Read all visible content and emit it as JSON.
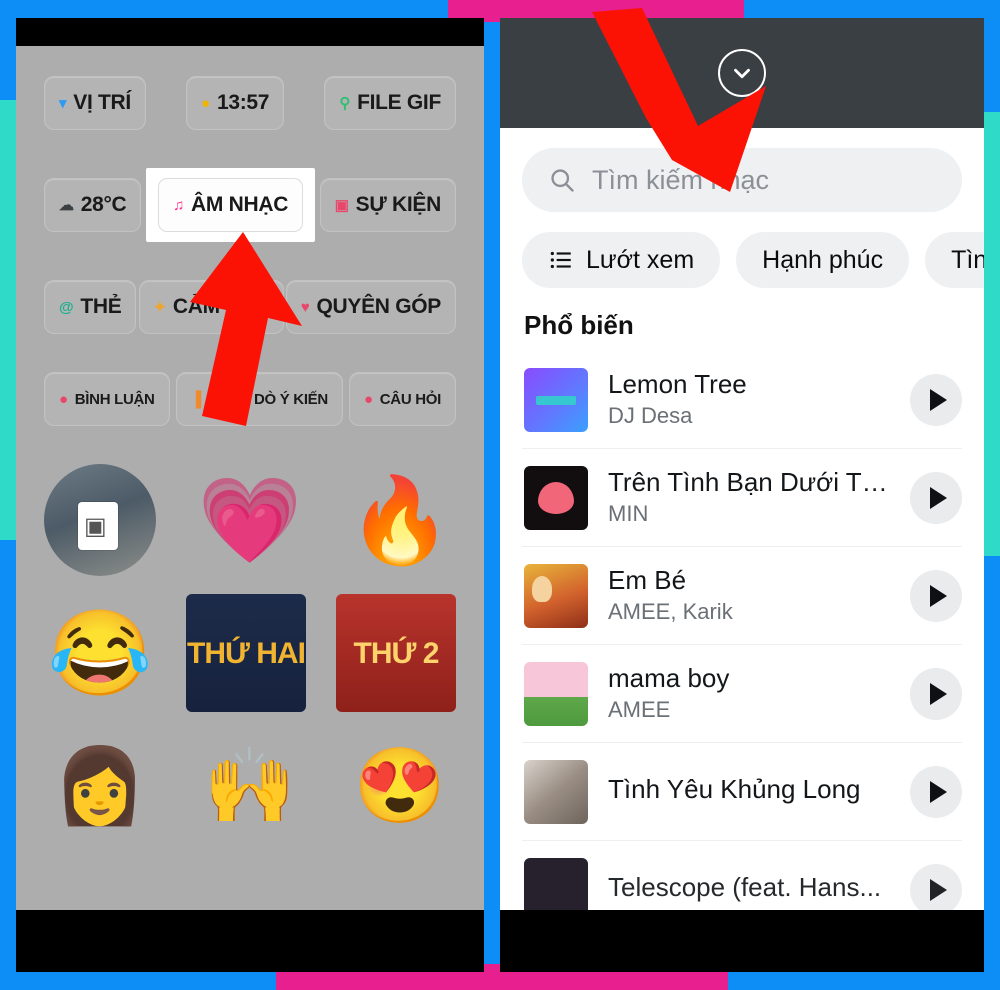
{
  "frame": {
    "accent_blue": "#0d8ef7",
    "accent_teal": "#2fdac8",
    "accent_pink": "#e81f8e",
    "arrow_color": "#fb1205"
  },
  "left_panel": {
    "name": "facebook-story-sticker-tray",
    "background": "#adadad",
    "chip_rows": [
      [
        {
          "label": "VỊ TRÍ",
          "icon": "location-pin-icon",
          "icon_glyph": "▾",
          "icon_color": "#2e9bf0"
        },
        {
          "label": "13:57",
          "icon": "clock-icon",
          "icon_glyph": "●",
          "icon_color": "#f0b400"
        },
        {
          "label": "FILE GIF",
          "icon": "gif-search-icon",
          "icon_glyph": "⚲",
          "icon_color": "#2fbf71"
        }
      ],
      [
        {
          "label": "28°C",
          "icon": "weather-cloud-icon",
          "icon_glyph": "☁",
          "icon_color": "#3c4043"
        },
        {
          "label": "ÂM NHẠC",
          "icon": "music-note-icon",
          "icon_glyph": "♫",
          "icon_color": "#ff2d8d",
          "highlighted": true
        },
        {
          "label": "SỰ KIỆN",
          "icon": "calendar-icon",
          "icon_glyph": "▣",
          "icon_color": "#e8466a"
        }
      ],
      [
        {
          "label": "THẺ",
          "icon": "mention-at-icon",
          "icon_glyph": "@",
          "icon_color": "#1fae8f"
        },
        {
          "label": "CẢM XÚC",
          "icon": "feeling-star-icon",
          "icon_glyph": "✦",
          "icon_color": "#f0a52a"
        },
        {
          "label": "QUYÊN GÓP",
          "icon": "donate-heart-icon",
          "icon_glyph": "♥",
          "icon_color": "#e8466a"
        }
      ],
      [
        {
          "label": "BÌNH LUẬN",
          "icon": "comment-bubble-icon",
          "icon_glyph": "●",
          "icon_color": "#e8466a",
          "small": true
        },
        {
          "label": "THĂM DÒ Ý KIẾN",
          "icon": "poll-bars-icon",
          "icon_glyph": "▐",
          "icon_color": "#f08a2a",
          "small": true
        },
        {
          "label": "CÂU HỎI",
          "icon": "question-bubble-icon",
          "icon_glyph": "●",
          "icon_color": "#e8466a",
          "small": true
        }
      ]
    ],
    "sticker_rows": [
      [
        {
          "name": "avatar-photo-sticker",
          "kind": "avatar"
        },
        {
          "name": "heart-face-sticker",
          "kind": "emoji",
          "glyph": "💗"
        },
        {
          "name": "fire-sticker",
          "kind": "emoji",
          "glyph": "🔥"
        }
      ],
      [
        {
          "name": "joy-emoji-sticker",
          "kind": "emoji",
          "glyph": "😂"
        },
        {
          "name": "thu-hai-text-sticker",
          "kind": "text",
          "text": "THỨ HAI"
        },
        {
          "name": "thu-2-text-sticker",
          "kind": "text",
          "text": "THỨ 2"
        }
      ],
      [
        {
          "name": "memoji-glasses-sticker",
          "kind": "emoji",
          "glyph": "👩"
        },
        {
          "name": "memoji-yes-sticker",
          "kind": "emoji",
          "glyph": "🙌"
        },
        {
          "name": "memoji-hearteyes-sticker",
          "kind": "emoji",
          "glyph": "😍"
        }
      ]
    ]
  },
  "right_panel": {
    "name": "music-picker-sheet",
    "collapse_icon": "chevron-down-circle-icon",
    "search": {
      "icon": "search-icon",
      "placeholder": "Tìm kiếm nhạc",
      "value": ""
    },
    "category_pills": [
      {
        "label": "Lướt xem",
        "icon": "list-icon"
      },
      {
        "label": "Hạnh phúc",
        "icon": ""
      },
      {
        "label": "Tình y",
        "icon": ""
      }
    ],
    "section_title": "Phổ biến",
    "songs": [
      {
        "title": "Lemon Tree",
        "artist": "DJ Desa",
        "art": "art-lemon",
        "play_icon": "play-icon"
      },
      {
        "title": "Trên Tình Bạn Dưới Tìn...",
        "artist": "MIN",
        "art": "art-tren",
        "play_icon": "play-icon"
      },
      {
        "title": "Em Bé",
        "artist": "AMEE, Karik",
        "art": "art-embe",
        "play_icon": "play-icon"
      },
      {
        "title": "mama boy",
        "artist": "AMEE",
        "art": "art-mama",
        "play_icon": "play-icon"
      },
      {
        "title": "Tình Yêu Khủng Long",
        "artist": "",
        "art": "art-tinh",
        "play_icon": "play-icon"
      },
      {
        "title": "Telescope (feat. Hans...",
        "artist": "",
        "art": "art-tele",
        "play_icon": "play-icon"
      }
    ]
  }
}
